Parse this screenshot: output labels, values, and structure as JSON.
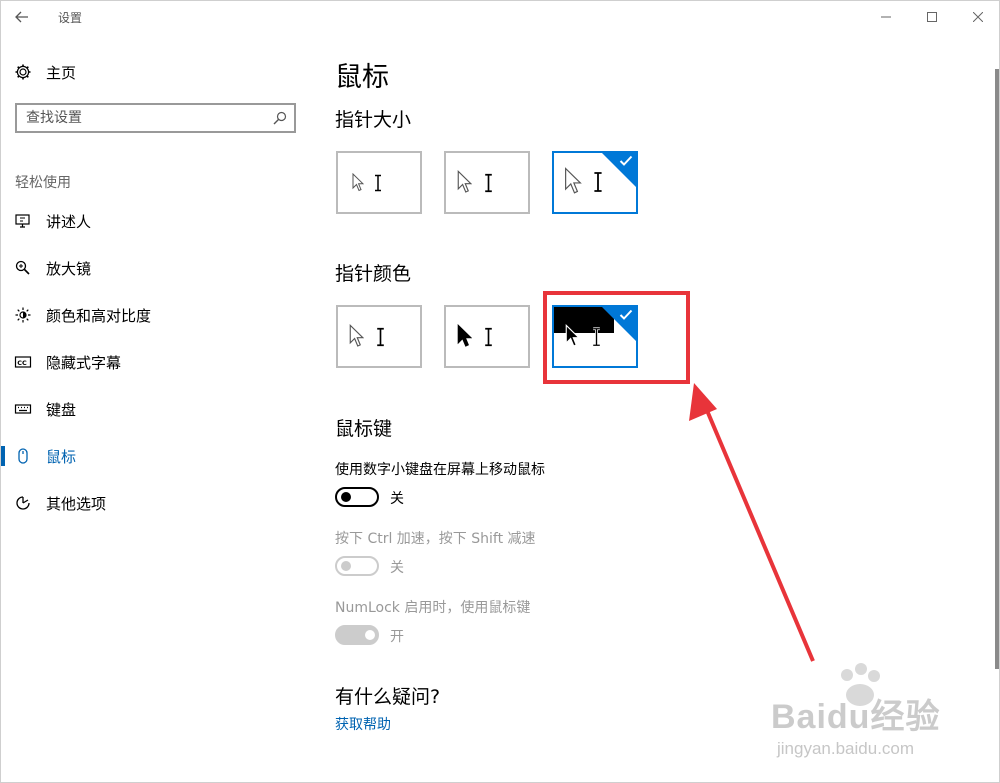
{
  "window": {
    "title": "设置"
  },
  "sidebar": {
    "home_label": "主页",
    "search": {
      "placeholder": "查找设置"
    },
    "section_label": "轻松使用",
    "items": [
      {
        "label": "讲述人",
        "icon": "narrator-icon"
      },
      {
        "label": "放大镜",
        "icon": "magnifier-icon"
      },
      {
        "label": "颜色和高对比度",
        "icon": "brightness-icon"
      },
      {
        "label": "隐藏式字幕",
        "icon": "closed-caption-icon"
      },
      {
        "label": "键盘",
        "icon": "keyboard-icon"
      },
      {
        "label": "鼠标",
        "icon": "mouse-icon",
        "active": true
      },
      {
        "label": "其他选项",
        "icon": "other-options-icon"
      }
    ]
  },
  "main": {
    "title": "鼠标",
    "pointer_size": {
      "heading": "指针大小",
      "options": [
        "small",
        "medium",
        "large"
      ],
      "selected_index": 2
    },
    "pointer_color": {
      "heading": "指针颜色",
      "options": [
        "white",
        "black",
        "inverted"
      ],
      "selected_index": 2
    },
    "mouse_keys": {
      "heading": "鼠标键",
      "toggles": [
        {
          "label": "使用数字小键盘在屏幕上移动鼠标",
          "state": "关",
          "on": false,
          "enabled": true
        },
        {
          "label": "按下 Ctrl 加速，按下 Shift 减速",
          "state": "关",
          "on": false,
          "enabled": false
        },
        {
          "label": "NumLock 启用时，使用鼠标键",
          "state": "开",
          "on": true,
          "enabled": false
        }
      ]
    },
    "help": {
      "heading": "有什么疑问?",
      "link": "获取帮助"
    }
  },
  "watermark": {
    "main": "Baidu经验",
    "sub": "jingyan.baidu.com"
  },
  "colors": {
    "accent": "#0078d7",
    "link": "#0063b1",
    "annotation": "#e8343a"
  }
}
